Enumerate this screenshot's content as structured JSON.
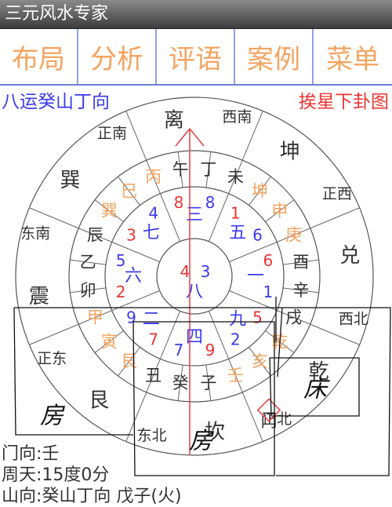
{
  "app_title": "三元风水专家",
  "tabs": [
    "布局",
    "分析",
    "评语",
    "案例",
    "菜单"
  ],
  "info": {
    "left": "八运癸山丁向",
    "right": "挨星下卦图"
  },
  "colors": {
    "accent_orange": "#f4a460",
    "blue": "#3a3aee",
    "red": "#ee3333",
    "title_bg": "#555555"
  },
  "outer_ring": [
    {
      "kind": "dir",
      "text": "正南"
    },
    {
      "kind": "gua",
      "text": "离"
    },
    {
      "kind": "dir",
      "text": "西南"
    },
    {
      "kind": "gua",
      "text": "坤"
    },
    {
      "kind": "dir",
      "text": "正西"
    },
    {
      "kind": "gua",
      "text": "兑"
    },
    {
      "kind": "dir",
      "text": "西北"
    },
    {
      "kind": "gua",
      "text": "乾"
    },
    {
      "kind": "dir",
      "text": "正北"
    },
    {
      "kind": "gua",
      "text": "坎"
    },
    {
      "kind": "dir",
      "text": "东北"
    },
    {
      "kind": "gua",
      "text": "艮"
    },
    {
      "kind": "dir",
      "text": "正东"
    },
    {
      "kind": "gua",
      "text": "震"
    },
    {
      "kind": "dir",
      "text": "东南"
    },
    {
      "kind": "gua",
      "text": "巽"
    }
  ],
  "mountains": [
    "午",
    "丁",
    "未",
    "坤",
    "申",
    "庚",
    "酉",
    "辛",
    "戌",
    "乾",
    "亥",
    "壬",
    "子",
    "癸",
    "丑",
    "艮",
    "寅",
    "甲",
    "卯",
    "乙",
    "辰",
    "巽",
    "巳",
    "丙"
  ],
  "mountain_colors": [
    "g",
    "g",
    "g",
    "o",
    "o",
    "o",
    "g",
    "g",
    "g",
    "o",
    "o",
    "o",
    "g",
    "g",
    "g",
    "o",
    "o",
    "o",
    "g",
    "g",
    "g",
    "o",
    "o",
    "o"
  ],
  "palaces": [
    {
      "name": "三",
      "mountain": "8",
      "water": "8"
    },
    {
      "name": "五",
      "mountain": "1",
      "water": "6"
    },
    {
      "name": "一",
      "mountain": "6",
      "water": "1"
    },
    {
      "name": "九",
      "mountain": "5",
      "water": "2"
    },
    {
      "name": "四",
      "mountain": "9",
      "water": "7"
    },
    {
      "name": "二",
      "mountain": "7",
      "water": "9"
    },
    {
      "name": "六",
      "mountain": "2",
      "water": "5"
    },
    {
      "name": "七",
      "mountain": "3",
      "water": "4"
    }
  ],
  "center": {
    "name": "八",
    "mountain": "4",
    "water": "3"
  },
  "gate_label": "门",
  "handwriting": {
    "a": "房",
    "b": "床",
    "c": "房"
  },
  "bottom": [
    "门向:壬",
    "周天:15度0分",
    "山向:癸山丁向 戊子(火)"
  ]
}
